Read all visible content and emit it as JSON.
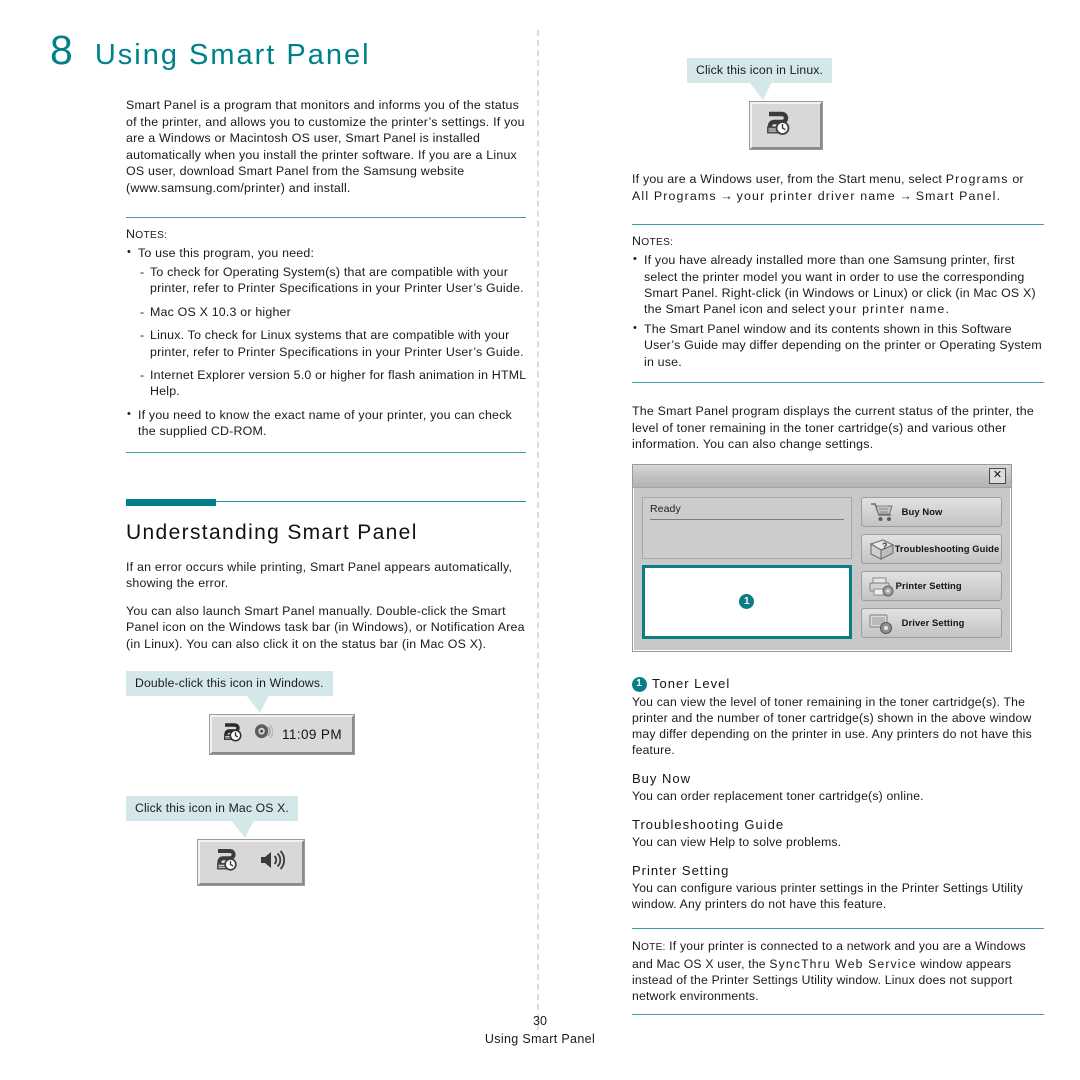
{
  "chapter": {
    "number": "8",
    "title": "Using Smart Panel"
  },
  "intro": {
    "paragraph": "Smart Panel is a program that monitors and informs you of the status of the printer, and allows you to customize the printer’s settings. If you are a Windows or Macintosh OS user, Smart Panel is installed automatically when you install the printer software. If you are a Linux OS user, download Smart Panel from the Samsung website (www.samsung.com/printer) and install."
  },
  "notes_left": {
    "label_first": "N",
    "label_rest": "OTES:",
    "items": [
      {
        "text": "To use this program, you need:",
        "sub": [
          "To check for Operating System(s) that are compatible with your printer, refer to Printer Specifications in your Printer User’s Guide.",
          "Mac OS X 10.3 or higher",
          "Linux. To check for Linux systems that are compatible with your printer, refer to Printer Specifications in your Printer User’s Guide.",
          "Internet Explorer version 5.0 or higher for flash animation in HTML Help."
        ]
      },
      {
        "text": "If you need to know the exact name of your printer, you can check the supplied CD-ROM.",
        "sub": []
      }
    ]
  },
  "section_understanding": {
    "title": "Understanding Smart Panel",
    "paragraph_1": "If an error occurs while printing, Smart Panel appears automatically, showing the error.",
    "paragraph_2": "You can also launch Smart Panel manually. Double-click the Smart Panel icon on the Windows task bar (in Windows), or Notification Area (in Linux). You can also click it on the status bar (in Mac OS X)."
  },
  "callouts": {
    "windows": {
      "balloon": "Double-click this icon in Windows.",
      "tray_time": "11:09 PM"
    },
    "macosx": {
      "balloon": "Click this icon in Mac OS X."
    },
    "linux": {
      "balloon": "Click this icon in Linux."
    }
  },
  "right_intro": {
    "paragraph": "If you are a Windows user, from the Start menu, select Programs or All Programs → your printer driver name → Smart Panel.",
    "plain_lead": "If you are a Windows user, from the Start menu, select ",
    "bold_1": "Programs",
    "mid_1": " or ",
    "bold_2": "All Programs",
    "arrow_1": " → ",
    "bold_3": "your printer driver name",
    "arrow_2": " → ",
    "bold_4": "Smart Panel",
    "tail": "."
  },
  "notes_right": {
    "label_first": "N",
    "label_rest": "OTES:",
    "items": [
      "If you have already installed more than one Samsung printer, first select the printer model you want in order to use the corresponding Smart Panel. Right-click (in Windows or Linux) or click (in Mac OS X) the Smart Panel icon and select your printer name.",
      "The Smart Panel window and its contents shown in this Software User’s Guide may differ depending on the printer or Operating System in use."
    ],
    "item1_plain": "If you have already installed more than one Samsung printer, first select the printer model you want in order to use the corresponding Smart Panel. Right-click (in Windows or Linux) or click (in Mac OS X) the Smart Panel icon and select ",
    "item1_bold": "your printer name",
    "item1_tail": "."
  },
  "program_desc": {
    "paragraph": "The Smart Panel program displays the current status of the printer, the level of toner remaining in the toner cartridge(s) and various other information. You can also change settings."
  },
  "smart_panel_window": {
    "close_label": "✕",
    "status_text": "Ready",
    "toner_badge": "1",
    "buttons": [
      {
        "label": "Buy Now",
        "icon": "shopping-cart-icon"
      },
      {
        "label": "Troubleshooting Guide",
        "icon": "help-book-icon"
      },
      {
        "label": "Printer Setting",
        "icon": "printer-gear-icon"
      },
      {
        "label": "Driver Setting",
        "icon": "driver-gear-icon"
      }
    ]
  },
  "descriptions": {
    "toner_level": {
      "badge": "1",
      "heading": "Toner Level",
      "body": "You can view the level of toner remaining in the toner cartridge(s). The printer and the number of toner cartridge(s) shown in the above window may differ depending on the printer in use. Any printers do not have this feature."
    },
    "buy_now": {
      "heading": "Buy Now",
      "body": "You can order replacement toner cartridge(s) online."
    },
    "troubleshooting_guide": {
      "heading": "Troubleshooting Guide",
      "body": "You can view Help to solve problems."
    },
    "printer_setting": {
      "heading": "Printer Setting",
      "body": "You can configure various printer settings in the Printer Settings Utility window. Any printers do not have this feature."
    }
  },
  "note_bottom": {
    "label_first": "N",
    "label_rest": "OTE:",
    "plain_1": " If your printer is connected to a network and you are a Windows and Mac OS X user, the ",
    "bold_1": "SyncThru Web Service",
    "plain_2": " window appears instead of the Printer Settings Utility window. Linux does not support network environments."
  },
  "footer": {
    "page_number": "30",
    "chapter_name": "Using Smart Panel"
  },
  "colors": {
    "teal": "#00818a",
    "teal_rule": "#3f9aa4",
    "balloon_bg": "#d4e8ea",
    "toner_border": "#0b7d85"
  }
}
